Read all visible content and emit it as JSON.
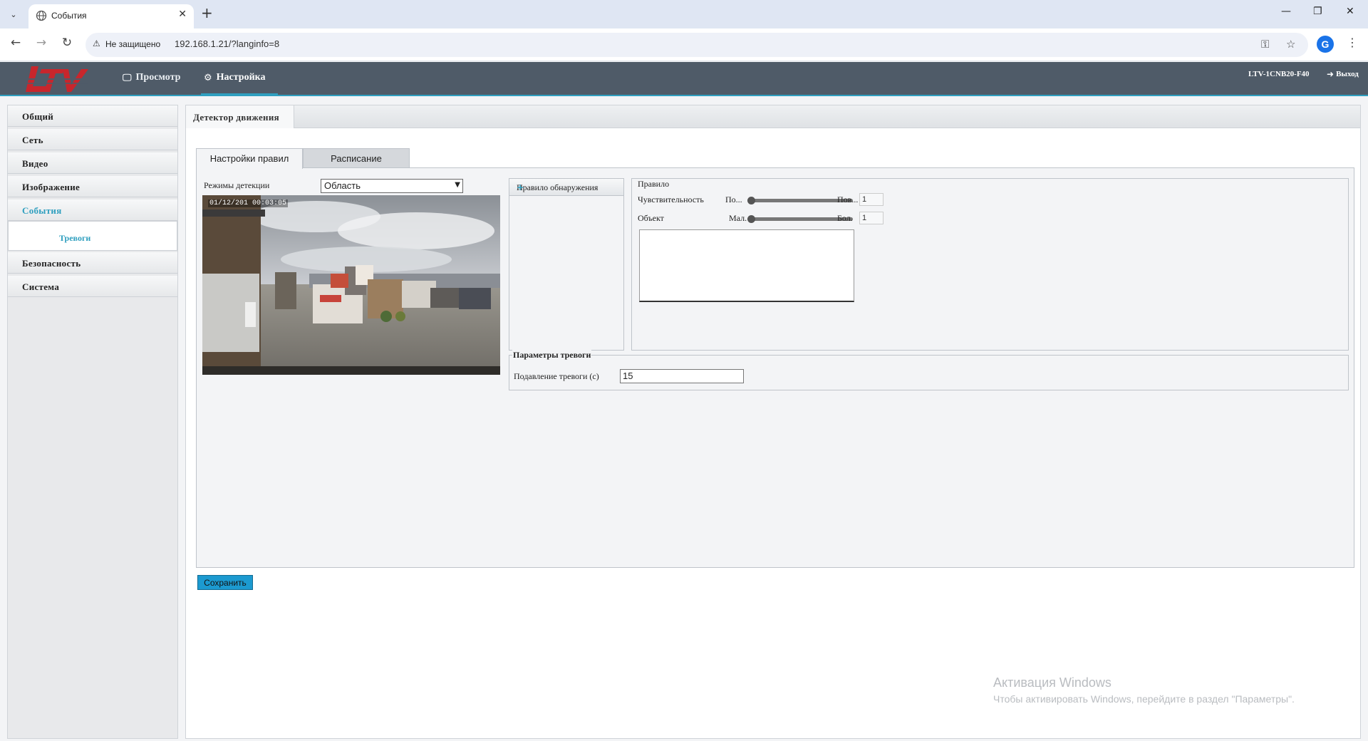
{
  "browser": {
    "tab_title": "События",
    "security_label": "Не защищено",
    "url": "192.168.1.21/?langinfo=8",
    "profile_initial": "G"
  },
  "header": {
    "nav": [
      {
        "label": "Просмотр",
        "icon": "monitor-icon",
        "active": false
      },
      {
        "label": "Настройка",
        "icon": "gear-icon",
        "active": true
      }
    ],
    "device_name": "LTV-1CNB20-F40",
    "logout_label": "Выход",
    "accent_color": "#2f9fbf"
  },
  "sidebar": {
    "items": [
      {
        "label": "Общий"
      },
      {
        "label": "Сеть"
      },
      {
        "label": "Видео"
      },
      {
        "label": "Изображение"
      },
      {
        "label": "События",
        "active": true
      },
      {
        "label": "Безопасность"
      },
      {
        "label": "Система"
      }
    ],
    "sub_item": "Тревоги"
  },
  "main": {
    "section_tab": "Детектор движения",
    "tabs": [
      {
        "label": "Настройки правил",
        "active": true
      },
      {
        "label": "Расписание",
        "active": false
      }
    ],
    "detection_mode_label": "Режимы детекции",
    "detection_mode_value": "Область",
    "video_timestamp": "01/12/201  00:03:05",
    "rule_list_header": "Правило обнаружения",
    "rule": {
      "legend": "Правило",
      "sensitivity_label": "Чувствительность",
      "sensitivity_min": "По...",
      "sensitivity_max": "Пов...",
      "sensitivity_value": "1",
      "object_label": "Объект",
      "object_min": "Мал.",
      "object_max": "Бол.",
      "object_value": "1"
    },
    "alarm": {
      "legend": "Параметры тревоги",
      "suppress_label": "Подавление тревоги (с)",
      "suppress_value": "15"
    },
    "save_label": "Сохранить"
  },
  "watermark": {
    "title": "Активация Windows",
    "text": "Чтобы активировать Windows, перейдите в раздел \"Параметры\"."
  }
}
